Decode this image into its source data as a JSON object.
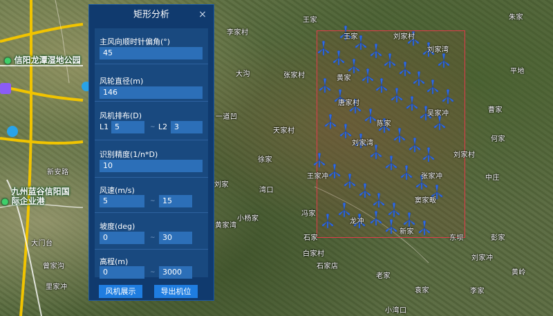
{
  "panel": {
    "title": "矩形分析",
    "close": "×",
    "fields": {
      "wind_angle": {
        "label": "主风向顺时针偏角(°)",
        "value": "45"
      },
      "rotor_diameter": {
        "label": "风轮直径(m)",
        "value": "146"
      },
      "layout": {
        "label": "风机排布(D)",
        "l1_label": "L1",
        "l1_value": "5",
        "l2_label": "L2",
        "l2_value": "3"
      },
      "precision": {
        "label": "识别精度(1/n*D)",
        "value": "10"
      },
      "wind_speed": {
        "label": "风速(m/s)",
        "min": "5",
        "max": "15"
      },
      "slope": {
        "label": "坡度(deg)",
        "min": "0",
        "max": "30"
      },
      "elevation": {
        "label": "高程(m)",
        "min": "0",
        "max": "3000"
      }
    },
    "tilde": "~",
    "buttons": {
      "show": "风机展示",
      "export": "导出机位"
    }
  },
  "map": {
    "pois": [
      "信阳龙潭湿地公园",
      "九州蓝谷信阳国际企业港"
    ],
    "labels": [
      "李家村",
      "大沟",
      "刘家村",
      "王家",
      "刘家湾",
      "平地",
      "黄家",
      "唐家村",
      "吴家冲",
      "张家村",
      "一道凹",
      "天家村",
      "陈家",
      "曹家",
      "何家",
      "王家",
      "朱家",
      "刘家湾",
      "刘家村",
      "中庄",
      "徐家",
      "王家冲",
      "张家冲",
      "刘家",
      "湾口",
      "窦家畈",
      "小杨家",
      "冯家",
      "黄家湾",
      "龙冲",
      "新家",
      "石家",
      "东坝",
      "彭家",
      "刘家冲",
      "白家村",
      "老家",
      "石家店",
      "新安路",
      "大门台",
      "曾家沟",
      "里家冲",
      "袁家",
      "黄岭",
      "李家",
      "小湾口"
    ],
    "icons": [
      "tree-icon",
      "hospital-icon",
      "bus-icon",
      "lodging-icon"
    ],
    "colors": {
      "rect_border": "#e23a4a",
      "turbine": "#2f6be3"
    }
  }
}
